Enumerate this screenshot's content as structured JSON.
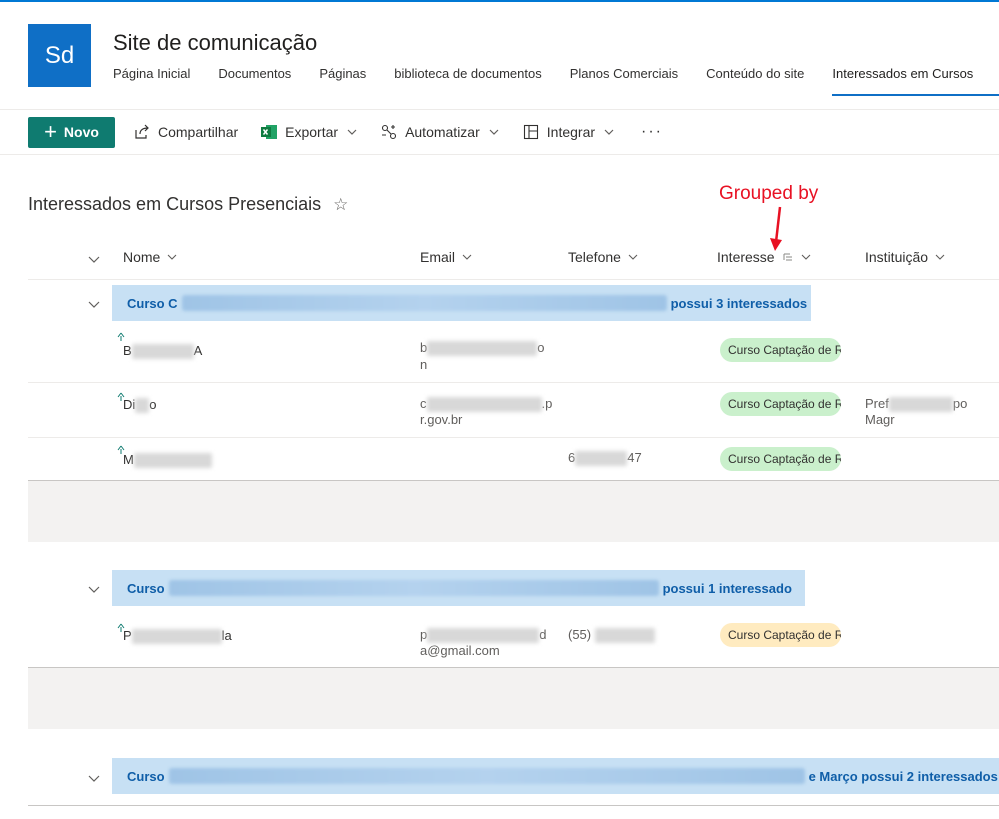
{
  "site": {
    "logo": "Sd",
    "title": "Site de comunicação",
    "nav": [
      "Página Inicial",
      "Documentos",
      "Páginas",
      "biblioteca de documentos",
      "Planos Comerciais",
      "Conteúdo do site",
      "Interessados em Cursos"
    ]
  },
  "commands": {
    "new_label": "Novo",
    "share_label": "Compartilhar",
    "export_label": "Exportar",
    "automate_label": "Automatizar",
    "integrate_label": "Integrar",
    "more_label": "···"
  },
  "list": {
    "title": "Interessados em Cursos Presenciais",
    "columns": [
      "Nome",
      "Email",
      "Telefone",
      "Interesse",
      "Instituição"
    ]
  },
  "annotation": {
    "text": "Grouped by",
    "color": "#e81123"
  },
  "groups": [
    {
      "prefix": "Curso C",
      "suffix": "possui 3 interessados",
      "rows": [
        {
          "name_start": "B",
          "name_end": "A",
          "email_start": "b",
          "email_end": "o",
          "email_line2": "n",
          "phone": "",
          "interest": "Curso Captação de Re",
          "institution": ""
        },
        {
          "name_start": "Di",
          "name_end": "o",
          "email_start": "c",
          "email_end": ".p",
          "email_line2": "r.gov.br",
          "phone": "",
          "interest": "Curso Captação de Re",
          "institution": "Pref",
          "institution_end": "po",
          "institution_line2": "Magr"
        },
        {
          "name_start": "M",
          "name_end": "",
          "email_start": "",
          "email_end": "",
          "email_line2": "",
          "phone_start": "6",
          "phone_end": "47",
          "interest": "Curso Captação de Re",
          "institution": ""
        }
      ]
    },
    {
      "prefix": "Curso",
      "suffix": "possui 1 interessado",
      "rows": [
        {
          "name_start": "P",
          "name_end": "la",
          "email_start": "p",
          "email_end": "d",
          "email_line2": "a@gmail.com",
          "phone_start": "(55)",
          "phone_end": "",
          "interest": "Curso Captação de Re",
          "institution": ""
        }
      ]
    },
    {
      "prefix": "Curso",
      "suffix": "e Março possui 2 interessados",
      "rows": []
    }
  ],
  "colors": {
    "new_button": "#0f7b70",
    "group_header": "#c7e0f4",
    "badge_green": "#caf0cc",
    "badge_yellow": "#ffebc0"
  }
}
